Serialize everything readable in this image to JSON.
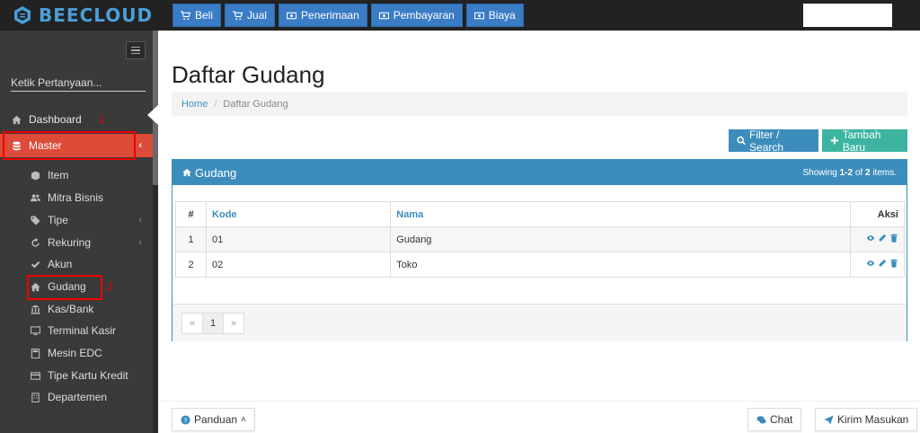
{
  "app": {
    "name": "BEECLOUD",
    "brand_color": "#4a9fd8"
  },
  "topnav": [
    {
      "label": "Beli",
      "icon": "cart-icon"
    },
    {
      "label": "Jual",
      "icon": "cart-icon"
    },
    {
      "label": "Penerimaan",
      "icon": "money-icon"
    },
    {
      "label": "Pembayaran",
      "icon": "money-icon"
    },
    {
      "label": "Biaya",
      "icon": "money-icon"
    }
  ],
  "sidebar": {
    "search_placeholder": "Ketik Pertanyaan...",
    "items": [
      {
        "label": "Dashboard",
        "icon": "home-icon"
      },
      {
        "label": "Master",
        "icon": "database-icon",
        "active": true
      },
      {
        "label": "Item",
        "icon": "cube-icon"
      },
      {
        "label": "Mitra Bisnis",
        "icon": "users-icon"
      },
      {
        "label": "Tipe",
        "icon": "tag-icon"
      },
      {
        "label": "Rekuring",
        "icon": "refresh-icon"
      },
      {
        "label": "Akun",
        "icon": "check-icon"
      },
      {
        "label": "Gudang",
        "icon": "home-icon"
      },
      {
        "label": "Kas/Bank",
        "icon": "bank-icon"
      },
      {
        "label": "Terminal Kasir",
        "icon": "monitor-icon"
      },
      {
        "label": "Mesin EDC",
        "icon": "calculator-icon"
      },
      {
        "label": "Tipe Kartu Kredit",
        "icon": "credit-card-icon"
      },
      {
        "label": "Departemen",
        "icon": "building-icon"
      }
    ],
    "annotations": [
      "1",
      "2"
    ]
  },
  "main": {
    "title": "Daftar Gudang",
    "breadcrumb": {
      "home": "Home",
      "current": "Daftar Gudang"
    },
    "filter_button": "Filter / Search",
    "add_button": "Tambah Baru",
    "panel": {
      "title": "Gudang",
      "summary_prefix": "Showing ",
      "summary_range": "1-2",
      "summary_mid": " of ",
      "summary_total": "2",
      "summary_suffix": " items."
    },
    "table": {
      "headers": {
        "num": "#",
        "kode": "Kode",
        "nama": "Nama",
        "aksi": "Aksi"
      },
      "rows": [
        {
          "num": "1",
          "kode": "01",
          "nama": "Gudang"
        },
        {
          "num": "2",
          "kode": "02",
          "nama": "Toko"
        }
      ]
    },
    "pager": {
      "prev": "«",
      "page": "1",
      "next": "»"
    }
  },
  "footer": {
    "guide": "Panduan",
    "chat": "Chat",
    "submit": "Kirim Masukan"
  }
}
